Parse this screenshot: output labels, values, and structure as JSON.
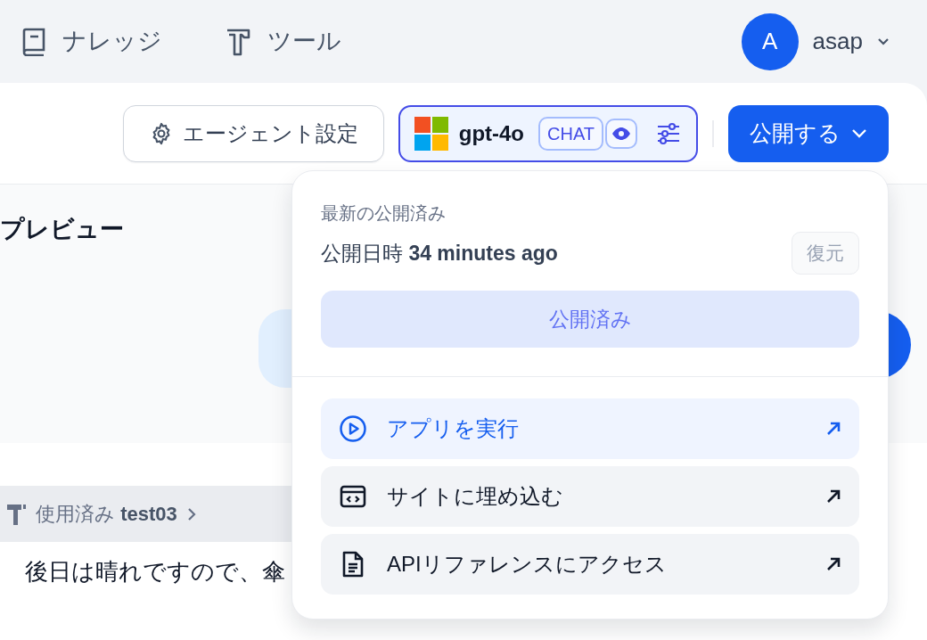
{
  "nav": {
    "items": [
      {
        "label": "ナレッジ",
        "kind": "knowledge"
      },
      {
        "label": "ツール",
        "kind": "tools"
      }
    ],
    "user": {
      "avatar": "A",
      "name": "asap"
    }
  },
  "toolbar": {
    "agent_settings": "エージェント設定",
    "model": {
      "name": "gpt-4o",
      "tag": "CHAT"
    },
    "publish": "公開する"
  },
  "preview": {
    "title": "プレビュー",
    "tool_usage": {
      "label": "使用済み",
      "name": "test03"
    },
    "message": "後日は晴れですので、傘"
  },
  "publish_menu": {
    "heading": "最新の公開済み",
    "published": "公開日時 **34 minutes ago**",
    "restore": {
      "label": "復元",
      "disabled": true
    },
    "published_button": {
      "label": "公開済み",
      "disabled": true
    },
    "actions": [
      {
        "label": "アプリを実行",
        "kind": "run",
        "selected": true
      },
      {
        "label": "サイトに埋め込む",
        "kind": "embed",
        "selected": false
      },
      {
        "label": "APIリファレンスにアクセス",
        "kind": "api",
        "selected": false
      }
    ]
  }
}
